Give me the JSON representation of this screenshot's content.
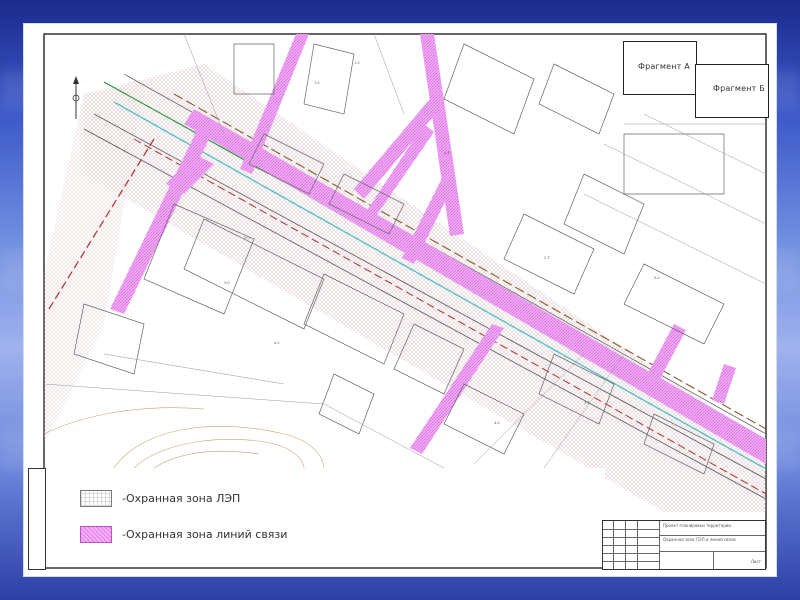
{
  "background": {
    "top_color": "#1b2a8c",
    "middle_color": "#9fb2ee",
    "bottom_color": "#2c3fa6"
  },
  "fragments": [
    {
      "label": "Фрагмент А"
    },
    {
      "label": "Фрагмент Б"
    }
  ],
  "legend": {
    "items": [
      {
        "icon": "power-line-zone-swatch",
        "label": "-Охранная зона ЛЭП"
      },
      {
        "icon": "comm-line-zone-swatch",
        "label": "-Охранная зона линий связи"
      }
    ]
  },
  "colors": {
    "comm_zone": "#e87bf0",
    "lep_zone": "#d9a0a0",
    "axis_green": "#2b9a3f",
    "axis_teal": "#3fbcc4",
    "dashed_red": "#b03030",
    "grid_dark": "#4a4a4a"
  },
  "stamp": {
    "title_text": "Проект планировки территории",
    "sheet_text": "Охранная зона ЛЭП и линий связи",
    "org_text": "Лист"
  }
}
